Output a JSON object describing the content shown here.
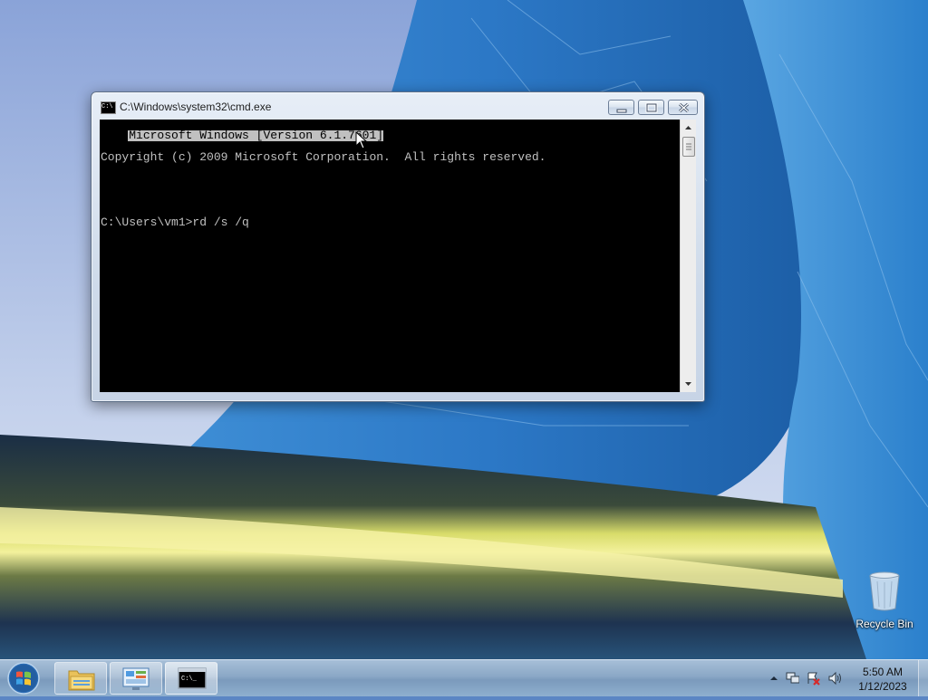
{
  "desktop": {
    "icons": [
      {
        "label": "Recycle Bin",
        "icon": "recycle-bin-icon"
      }
    ]
  },
  "window": {
    "title": "C:\\Windows\\system32\\cmd.exe",
    "app_icon": "cmd-icon",
    "app_icon_text": "C:\\",
    "controls": {
      "minimize": "minimize-icon",
      "maximize": "maximize-icon",
      "close": "close-icon"
    },
    "console_lines": [
      "Microsoft Windows [Version 6.1.7601]",
      "Copyright (c) 2009 Microsoft Corporation.  All rights reserved.",
      "",
      "C:\\Users\\vm1>rd /s /q"
    ]
  },
  "taskbar": {
    "start_icon": "windows-start-icon",
    "pinned": [
      {
        "name": "File Explorer",
        "icon": "folder-icon"
      },
      {
        "name": "Control Panel",
        "icon": "control-panel-icon"
      },
      {
        "name": "Command Prompt",
        "icon": "cmd-icon",
        "active": true
      }
    ],
    "tray": {
      "icons": [
        "show-hidden-icons-icon",
        "network-icon",
        "action-center-icon",
        "volume-icon"
      ],
      "time": "5:50 AM",
      "date": "1/12/2023"
    }
  },
  "colors": {
    "console_bg": "#000000",
    "console_fg": "#c0c0c0",
    "selection_bg": "#c0c0c0"
  }
}
